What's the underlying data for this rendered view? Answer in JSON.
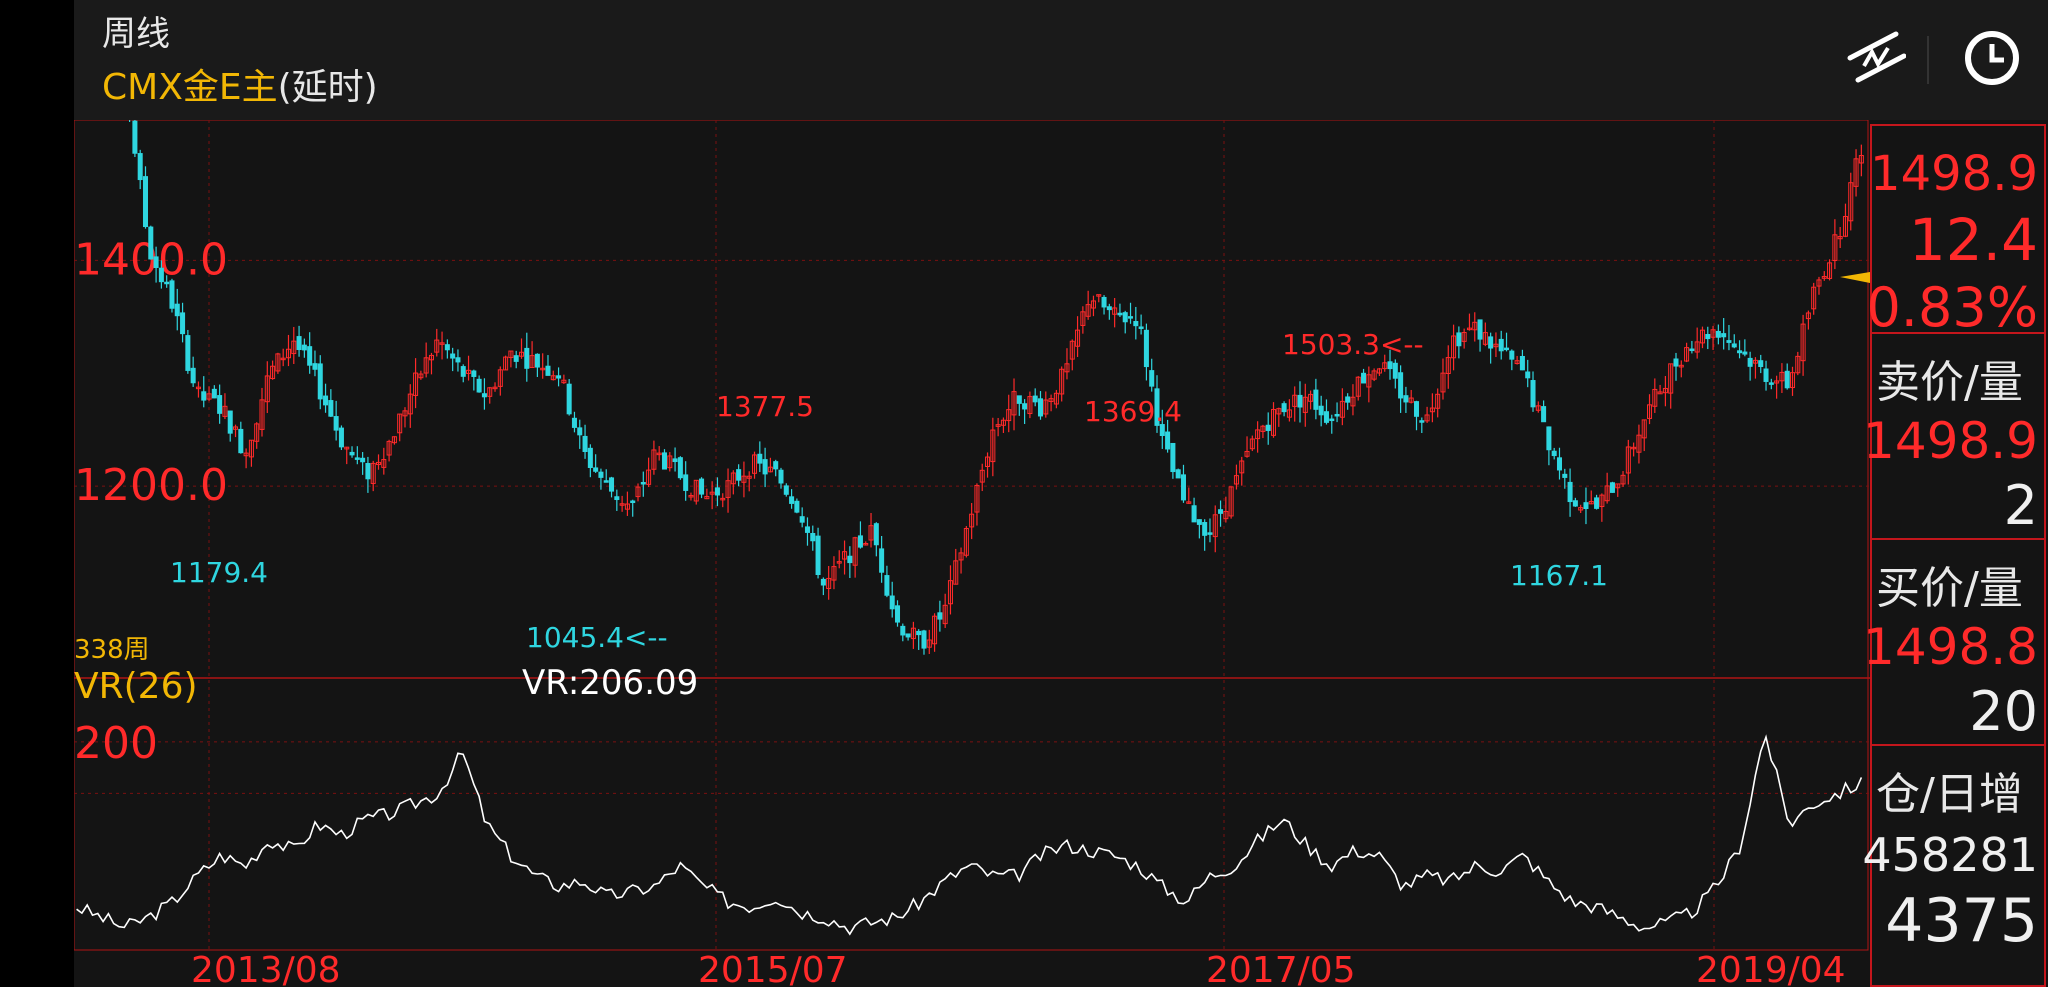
{
  "header": {
    "period": "周线",
    "instrument": "CMX金E主",
    "instrument_suffix": "(延时)"
  },
  "toolbar": {
    "indicator_icon": "trend-line-icon",
    "time_icon": "clock-icon"
  },
  "price_panel": {
    "last": "1498.9",
    "change": "12.4",
    "change_pct": "0.83%",
    "ask_label": "卖价/量",
    "ask_price": "1498.9",
    "ask_vol": "2",
    "bid_label": "买价/量",
    "bid_price": "1498.8",
    "bid_vol": "20",
    "oi_label": "仓/日增",
    "oi_value": "458281",
    "oi_change": "4375"
  },
  "indicator": {
    "bars_count": "338周",
    "name": "VR(26)",
    "value_label": "VR:206.09"
  },
  "colors": {
    "up": "#ff2a2a",
    "down": "#2fd6e0",
    "grid": "#7a1010",
    "vr_line": "#ffffff",
    "accent": "#f2b705"
  },
  "chart_data": [
    {
      "type": "candlestick",
      "x_ticks": [
        "2013/08",
        "2015/07",
        "2017/05",
        "2019/04"
      ],
      "y_ticks": [
        "1400.0",
        "1200.0"
      ],
      "ylim": [
        1030,
        1520
      ],
      "annotations": [
        {
          "label": "1179.4",
          "value": 1179.4,
          "date": "2013/09",
          "color": "down"
        },
        {
          "label": "1045.4<--",
          "value": 1045.4,
          "date": "2015/12",
          "color": "down"
        },
        {
          "label": "1377.5",
          "value": 1377.5,
          "date": "2016/07",
          "color": "up"
        },
        {
          "label": "1369.4",
          "value": 1369.4,
          "date": "2018/01",
          "color": "up"
        },
        {
          "label": "1167.1",
          "value": 1167.1,
          "date": "2018/08",
          "color": "down"
        },
        {
          "label": "1503.3<--",
          "value": 1503.3,
          "date": "2019/08",
          "color": "up"
        }
      ],
      "close_path": [
        1600,
        1540,
        1560,
        1410,
        1360,
        1280,
        1270,
        1230,
        1300,
        1330,
        1290,
        1240,
        1210,
        1240,
        1290,
        1330,
        1300,
        1280,
        1320,
        1310,
        1300,
        1230,
        1200,
        1180,
        1230,
        1210,
        1190,
        1200,
        1220,
        1210,
        1180,
        1110,
        1140,
        1160,
        1080,
        1060,
        1090,
        1170,
        1250,
        1280,
        1270,
        1300,
        1370,
        1350,
        1350,
        1240,
        1180,
        1160,
        1200,
        1250,
        1270,
        1280,
        1260,
        1290,
        1310,
        1280,
        1260,
        1330,
        1340,
        1320,
        1300,
        1240,
        1190,
        1180,
        1210,
        1260,
        1300,
        1330,
        1340,
        1320,
        1300,
        1290,
        1370,
        1420,
        1500
      ]
    },
    {
      "type": "line",
      "name": "VR(26)",
      "y_ticks": [
        "200"
      ],
      "ylim": [
        0,
        260
      ],
      "values": [
        40,
        30,
        20,
        30,
        45,
        70,
        90,
        80,
        105,
        95,
        120,
        110,
        125,
        130,
        140,
        150,
        190,
        120,
        90,
        70,
        60,
        65,
        50,
        55,
        60,
        80,
        60,
        45,
        40,
        50,
        35,
        30,
        20,
        25,
        30,
        45,
        65,
        80,
        70,
        70,
        90,
        100,
        95,
        90,
        80,
        60,
        45,
        70,
        80,
        105,
        125,
        100,
        80,
        95,
        90,
        60,
        70,
        65,
        80,
        75,
        90,
        65,
        45,
        40,
        30,
        20,
        25,
        35,
        60,
        100,
        210,
        120,
        140,
        150,
        160
      ]
    }
  ]
}
